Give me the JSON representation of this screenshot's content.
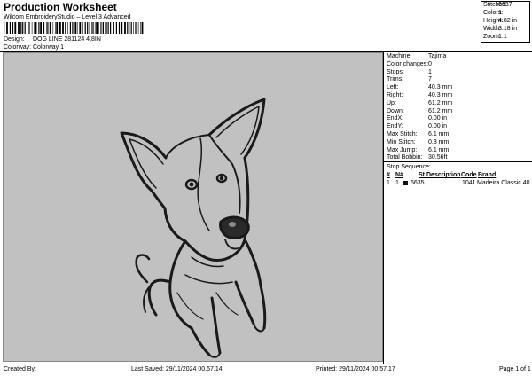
{
  "header": {
    "title": "Production Worksheet",
    "subtitle": "Wilcom EmbroideryStudio – Level 3 Advanced",
    "design_label": "Design:",
    "design_value": "DOG LINE 281124 4,8IN",
    "colorway_label": "Colorway:",
    "colorway_value": "Colorway 1"
  },
  "summary": [
    {
      "label": "Stitches:",
      "value": "6637"
    },
    {
      "label": "Colors:",
      "value": "1"
    },
    {
      "label": "Height:",
      "value": "4.82 in"
    },
    {
      "label": "Width:",
      "value": "3.18 in"
    },
    {
      "label": "Zoom:",
      "value": "1:1"
    }
  ],
  "info": [
    {
      "label": "Machine:",
      "value": "Tajima"
    },
    {
      "label": "Color changes:",
      "value": "0"
    },
    {
      "label": "Stops:",
      "value": "1"
    },
    {
      "label": "Trims:",
      "value": "7"
    },
    {
      "label": "Left:",
      "value": "40.3 mm"
    },
    {
      "label": "Right:",
      "value": "40.3 mm"
    },
    {
      "label": "Up:",
      "value": "61.2 mm"
    },
    {
      "label": "Down:",
      "value": "61.2 mm"
    },
    {
      "label": "EndX:",
      "value": "0.00 in"
    },
    {
      "label": "EndY:",
      "value": "0.00 in"
    },
    {
      "label": "Max Stitch:",
      "value": "6.1 mm"
    },
    {
      "label": "Min Stitch:",
      "value": "0.3 mm"
    },
    {
      "label": "Max Jump:",
      "value": "6.1 mm"
    },
    {
      "label": "Total Bobbin:",
      "value": "30.56ft"
    }
  ],
  "stop_sequence": {
    "title": "Stop Sequence:",
    "columns": [
      "#",
      "N#",
      "St.",
      "Description",
      "Code",
      "Brand"
    ],
    "rows": [
      {
        "index": "1.",
        "needle": "1",
        "stitches": "6635",
        "description": "",
        "code": "1041",
        "brand": "Madeira Classic 40",
        "color": "#111111"
      }
    ]
  },
  "footer": {
    "created_by": "Created By:",
    "last_saved": "Last Saved: 29/11/2024 00.57.14",
    "printed": "Printed: 29/11/2024 00.57.17",
    "page": "Page 1 of 1"
  }
}
